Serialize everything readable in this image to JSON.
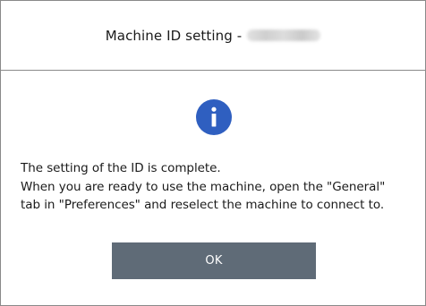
{
  "dialog": {
    "title": "Machine ID setting -",
    "icon": "info-icon",
    "message_lines": [
      "The setting of the ID is complete.",
      "When you are ready to use the machine, open the \"General\"",
      "tab in \"Preferences\" and reselect the machine to connect to."
    ],
    "ok_label": "OK"
  },
  "colors": {
    "icon_fill": "#2f5fc0",
    "button_bg": "#5f6b77",
    "border": "#8a8a8a"
  }
}
